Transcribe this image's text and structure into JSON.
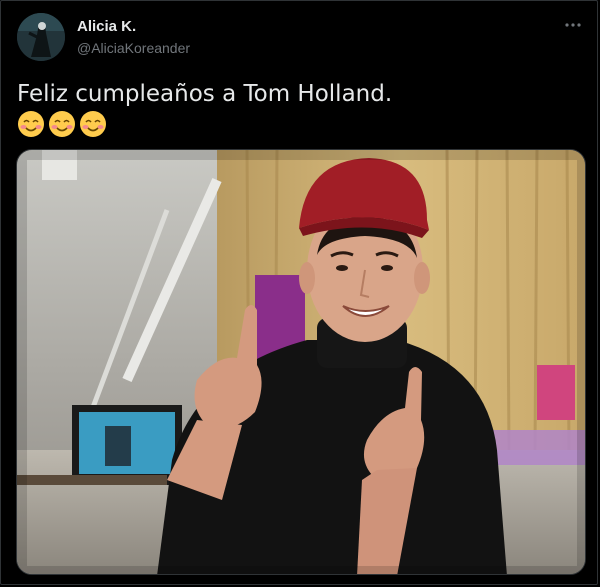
{
  "tweet": {
    "author_name": "Alicia K.",
    "author_handle": "@AliciaKoreander",
    "text": "Feliz cumpleaños a Tom Holland.",
    "emojis": [
      "smiling-face-with-smiling-eyes",
      "smiling-face-with-smiling-eyes",
      "smiling-face-with-smiling-eyes"
    ],
    "more_icon": "more-horizontal-icon"
  },
  "colors": {
    "background": "#000000",
    "text_primary": "#e7e9ea",
    "text_secondary": "#71767b",
    "border": "#2f3336"
  }
}
